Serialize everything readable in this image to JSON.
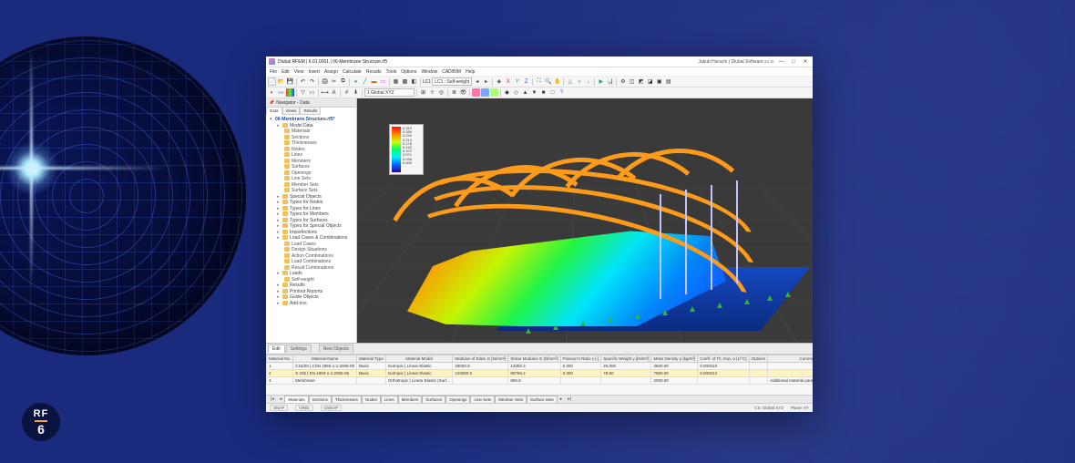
{
  "badge": {
    "rf": "RF",
    "six": "6"
  },
  "window": {
    "title": "Dlubal RFEM | 6.01.0001 | 06-Membrane Structure.rf5",
    "user": "Jakub Harazin | Dlubal Software s.r.o.",
    "min": "—",
    "max": "□",
    "close": "✕"
  },
  "menu": [
    "File",
    "Edit",
    "View",
    "Insert",
    "Assign",
    "Calculate",
    "Results",
    "Tools",
    "Options",
    "Window",
    "CAD/BIM",
    "Help"
  ],
  "toolbar2_combo": "LC1 : Self-weight",
  "toolbar3_combo": "1 Global XYZ",
  "navigator": {
    "header": "Navigator - Data",
    "tabs": [
      "Data",
      "Views",
      "Results"
    ],
    "root": "06-Membrane Structure.rf5*",
    "items": [
      {
        "l": 1,
        "t": "Model Data"
      },
      {
        "l": 2,
        "t": "Materials"
      },
      {
        "l": 2,
        "t": "Sections"
      },
      {
        "l": 2,
        "t": "Thicknesses"
      },
      {
        "l": 2,
        "t": "Nodes"
      },
      {
        "l": 2,
        "t": "Lines"
      },
      {
        "l": 2,
        "t": "Members"
      },
      {
        "l": 2,
        "t": "Surfaces"
      },
      {
        "l": 2,
        "t": "Openings"
      },
      {
        "l": 2,
        "t": "Line Sets"
      },
      {
        "l": 2,
        "t": "Member Sets"
      },
      {
        "l": 2,
        "t": "Surface Sets"
      },
      {
        "l": 1,
        "t": "Special Objects"
      },
      {
        "l": 1,
        "t": "Types for Nodes"
      },
      {
        "l": 1,
        "t": "Types for Lines"
      },
      {
        "l": 1,
        "t": "Types for Members"
      },
      {
        "l": 1,
        "t": "Types for Surfaces"
      },
      {
        "l": 1,
        "t": "Types for Special Objects"
      },
      {
        "l": 1,
        "t": "Imperfections"
      },
      {
        "l": 1,
        "t": "Load Cases & Combinations"
      },
      {
        "l": 2,
        "t": "Load Cases"
      },
      {
        "l": 2,
        "t": "Design Situations"
      },
      {
        "l": 2,
        "t": "Action Combinations"
      },
      {
        "l": 2,
        "t": "Load Combinations"
      },
      {
        "l": 2,
        "t": "Result Combinations"
      },
      {
        "l": 1,
        "t": "Loads"
      },
      {
        "l": 2,
        "t": "Self-weight"
      },
      {
        "l": 1,
        "t": "Results"
      },
      {
        "l": 1,
        "t": "Printout Reports"
      },
      {
        "l": 1,
        "t": "Guide Objects"
      },
      {
        "l": 1,
        "t": "Add-ons"
      }
    ]
  },
  "legend": {
    "title": "",
    "ticks": [
      "0.319",
      "0.284",
      "0.249",
      "0.213",
      "0.178",
      "0.142",
      "0.107",
      "0.071",
      "0.036",
      "0.000"
    ]
  },
  "panel": {
    "topTabs": [
      "Edit",
      "Settings"
    ],
    "subTab": "New Objects",
    "headers": [
      "Material No.",
      "Material Name",
      "Material Type",
      "Material Model",
      "Modulus of Elast. E [N/mm²]",
      "Shear Modulus G [N/mm²]",
      "Poisson's Ratio ν [-]",
      "Specific Weight γ [kN/m³]",
      "Mass Density ρ [kg/m³]",
      "Coeff. of Th. Exp. α [1/°C]",
      "Options",
      "Comment"
    ],
    "rows": [
      {
        "no": "1",
        "name": "C16/20 | CSN 1992-1-1:2005-08",
        "type": "Basic",
        "model": "Isotropic | Linear Elastic",
        "E": "29000.0",
        "G": "12083.3",
        "nu": "0.200",
        "gamma": "25.000",
        "rho": "2500.00",
        "alpha": "0.000010",
        "opt": "",
        "cmt": ""
      },
      {
        "no": "2",
        "name": "S 235 | EN 1993-1-1:2005-05",
        "type": "Basic",
        "model": "Isotropic | Linear Elastic",
        "E": "210000.0",
        "G": "80769.2",
        "nu": "0.300",
        "gamma": "78.50",
        "rho": "7850.00",
        "alpha": "0.000012",
        "opt": "",
        "cmt": ""
      },
      {
        "no": "3",
        "name": "Membrane",
        "type": "",
        "model": "Orthotropic | Linear Elastic (Surf…",
        "E": "",
        "G": "800.0",
        "nu": "",
        "gamma": "",
        "rho": "2000.00",
        "alpha": "",
        "opt": "",
        "cmt": "Additional material parameters are defin…"
      }
    ],
    "bottomTabs": [
      "Materials",
      "Sections",
      "Thicknesses",
      "Nodes",
      "Lines",
      "Members",
      "Surfaces",
      "Openings",
      "Line Sets",
      "Member Sets",
      "Surface Sets"
    ]
  },
  "status": {
    "snap": "SNAP",
    "grid": "GRID",
    "ortho": "OSNAP",
    "cs": "CS: Global XYZ",
    "plane": "Plane: XY"
  }
}
